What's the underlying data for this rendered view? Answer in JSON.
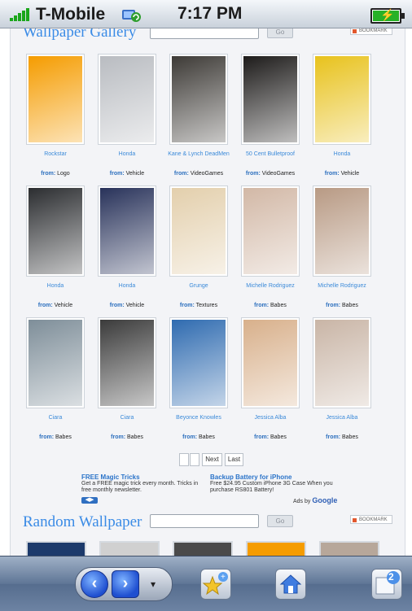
{
  "status_bar": {
    "carrier": "T-Mobile",
    "time": "7:17 PM",
    "signal_bars": 5,
    "battery_level": 1.0,
    "icons": [
      "signal-icon",
      "sync-icon",
      "battery-charging-icon"
    ]
  },
  "gallery": {
    "title": "Wallpaper Gallery",
    "search_button": "Go",
    "bookmark": "BOOKMARK",
    "items": [
      {
        "title": "Rockstar",
        "from_label": "from:",
        "category": "Logo",
        "color": "#f59c00"
      },
      {
        "title": "Honda",
        "from_label": "from:",
        "category": "Vehicle",
        "color": "#b9bcc1"
      },
      {
        "title": "Kane & Lynch DeadMen",
        "from_label": "from:",
        "category": "VideoGames",
        "color": "#3d3a36"
      },
      {
        "title": "50 Cent Bulletproof",
        "from_label": "from:",
        "category": "VideoGames",
        "color": "#1d1b1a"
      },
      {
        "title": "Honda",
        "from_label": "from:",
        "category": "Vehicle",
        "color": "#e8c21c"
      },
      {
        "title": "Honda",
        "from_label": "from:",
        "category": "Vehicle",
        "color": "#2b2d30"
      },
      {
        "title": "Honda",
        "from_label": "from:",
        "category": "Vehicle",
        "color": "#28325a"
      },
      {
        "title": "Grunge",
        "from_label": "from:",
        "category": "Textures",
        "color": "#e3cfac"
      },
      {
        "title": "Michelle Rodriguez",
        "from_label": "from:",
        "category": "Babes",
        "color": "#d2b8a6"
      },
      {
        "title": "Michelle Rodriguez",
        "from_label": "from:",
        "category": "Babes",
        "color": "#b89a84"
      },
      {
        "title": "Ciara",
        "from_label": "from:",
        "category": "Babes",
        "color": "#7e8e99"
      },
      {
        "title": "Ciara",
        "from_label": "from:",
        "category": "Babes",
        "color": "#3b3b3b"
      },
      {
        "title": "Beyonce Knowles",
        "from_label": "from:",
        "category": "Babes",
        "color": "#2f6bb0"
      },
      {
        "title": "Jessica Alba",
        "from_label": "from:",
        "category": "Babes",
        "color": "#d8b08b"
      },
      {
        "title": "Jessica Alba",
        "from_label": "from:",
        "category": "Babes",
        "color": "#c9b5a6"
      }
    ]
  },
  "pager": {
    "next": "Next",
    "last": "Last"
  },
  "ads": [
    {
      "title": "FREE Magic Tricks",
      "body": "Get a FREE magic trick every month. Tricks in free monthly newsletter."
    },
    {
      "title": "Backup Battery for iPhone",
      "body": "Free $24.95 Custom iPhone 3G Case When you purchase RS801 Battery!"
    }
  ],
  "ads_by": {
    "prefix": "Ads by",
    "brand": "Google"
  },
  "random": {
    "title": "Random Wallpaper",
    "search_button": "Go",
    "bookmark": "BOOKMARK",
    "thumb_colors": [
      "#1c3a6b",
      "#d0d0d0",
      "#4a4a4a",
      "#f59c00",
      "#b7a79a"
    ]
  },
  "toolbar": {
    "badge_count": "2",
    "icons": [
      "back-icon",
      "forward-icon",
      "add-bookmark-icon",
      "home-icon",
      "pages-icon"
    ]
  },
  "colors": {
    "link": "#3b8ad9",
    "title": "#3a8be6",
    "toolbar": "#5f7696"
  }
}
